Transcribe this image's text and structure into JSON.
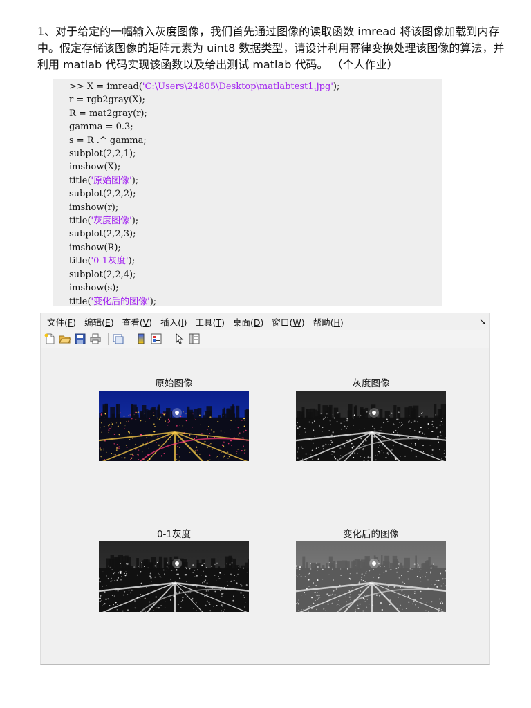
{
  "question": {
    "text": "1、对于给定的一幅输入灰度图像，我们首先通过图像的读取函数 imread 将该图像加载到内存中。假定存储该图像的矩阵元素为 uint8 数据类型，请设计利用幂律变换处理该图像的算法，并利用 matlab 代码实现该函数以及给出测试 matlab 代码。 （个人作业）"
  },
  "code": {
    "lines": [
      [
        {
          "t": ">> X = imread("
        },
        {
          "t": "'C:\\Users\\24805\\Desktop\\matlabtest1.jpg'",
          "s": 1
        },
        {
          "t": ");"
        }
      ],
      [
        {
          "t": "r = rgb2gray(X);"
        }
      ],
      [
        {
          "t": "R = mat2gray(r);"
        }
      ],
      [
        {
          "t": "gamma = 0.3;"
        }
      ],
      [
        {
          "t": "s = R .^ gamma;"
        }
      ],
      [
        {
          "t": "subplot(2,2,1);"
        }
      ],
      [
        {
          "t": "imshow(X);"
        }
      ],
      [
        {
          "t": "title("
        },
        {
          "t": "'原始图像'",
          "s": 1
        },
        {
          "t": ");"
        }
      ],
      [
        {
          "t": "subplot(2,2,2);"
        }
      ],
      [
        {
          "t": "imshow(r);"
        }
      ],
      [
        {
          "t": "title("
        },
        {
          "t": "'灰度图像'",
          "s": 1
        },
        {
          "t": ");"
        }
      ],
      [
        {
          "t": "subplot(2,2,3);"
        }
      ],
      [
        {
          "t": "imshow(R);"
        }
      ],
      [
        {
          "t": "title("
        },
        {
          "t": "'0-1灰度'",
          "s": 1
        },
        {
          "t": ");"
        }
      ],
      [
        {
          "t": "subplot(2,2,4);"
        }
      ],
      [
        {
          "t": "imshow(s);"
        }
      ],
      [
        {
          "t": "title("
        },
        {
          "t": "'变化后的图像'",
          "s": 1
        },
        {
          "t": ");"
        }
      ]
    ]
  },
  "figure_window": {
    "menu": [
      {
        "label": "文件",
        "key": "F"
      },
      {
        "label": "编辑",
        "key": "E"
      },
      {
        "label": "查看",
        "key": "V"
      },
      {
        "label": "插入",
        "key": "I"
      },
      {
        "label": "工具",
        "key": "T"
      },
      {
        "label": "桌面",
        "key": "D"
      },
      {
        "label": "窗口",
        "key": "W"
      },
      {
        "label": "帮助",
        "key": "H"
      }
    ],
    "dock_icon": "dock-arrow-icon",
    "toolbar": [
      "new-figure-icon",
      "open-file-icon",
      "save-icon",
      "print-icon",
      "sep",
      "link-plot-icon",
      "sep",
      "colorbar-icon",
      "legend-icon",
      "sep",
      "edit-plot-arrow-icon",
      "property-inspector-icon"
    ],
    "subplots": [
      {
        "title": "原始图像",
        "image": "color"
      },
      {
        "title": "灰度图像",
        "image": "gray"
      },
      {
        "title": "0-1灰度",
        "image": "gray"
      },
      {
        "title": "变化后的图像",
        "image": "bright"
      }
    ]
  },
  "colors": {
    "code_background": "#eeeeee",
    "code_string": "#a020f0",
    "figure_background": "#f0f0f0"
  }
}
